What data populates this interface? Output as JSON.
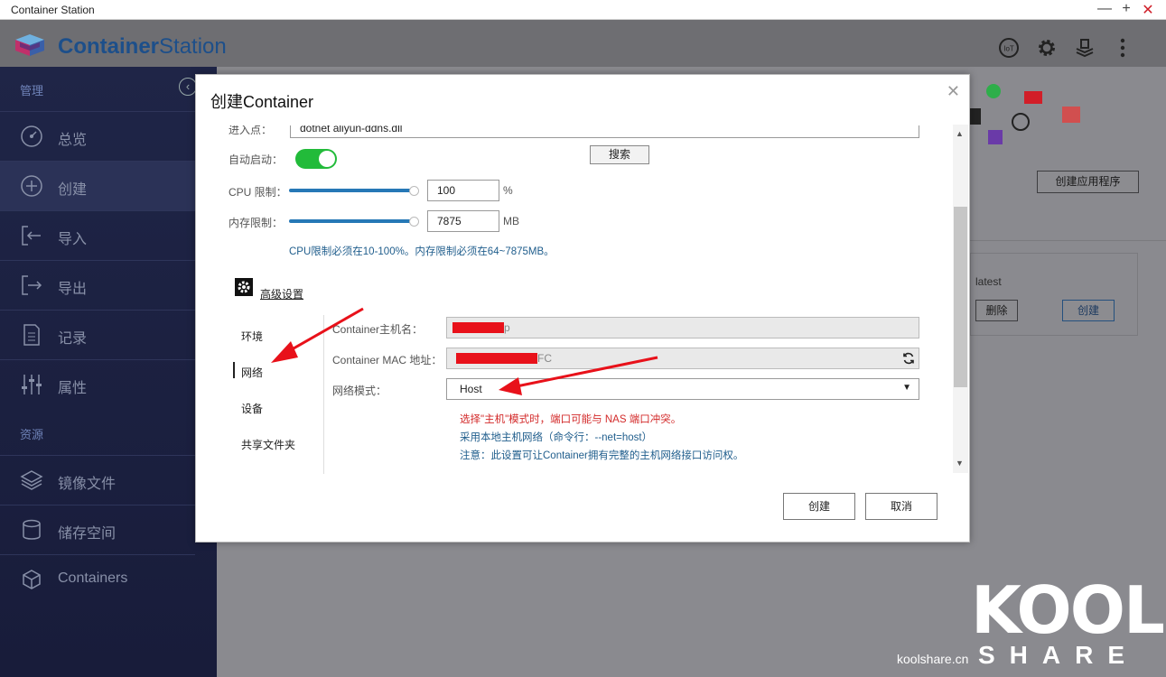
{
  "window": {
    "title": "Container Station",
    "minimize": "—",
    "maximize": "+",
    "close": "✕"
  },
  "header": {
    "brand_bold": "Container",
    "brand_light": "Station",
    "icons": [
      "iot-icon",
      "gear-icon",
      "layers-stack-icon",
      "more-vertical-icon"
    ],
    "iot_label": "IoT"
  },
  "sidebar": {
    "section_manage": "管理",
    "section_resources": "资源",
    "items": [
      {
        "label": "总览",
        "icon": "dashboard-icon"
      },
      {
        "label": "创建",
        "icon": "plus-circle-icon",
        "active": true
      },
      {
        "label": "导入",
        "icon": "import-icon"
      },
      {
        "label": "导出",
        "icon": "export-icon"
      },
      {
        "label": "记录",
        "icon": "document-icon"
      },
      {
        "label": "属性",
        "icon": "sliders-icon"
      }
    ],
    "resources": [
      {
        "label": "镜像文件",
        "icon": "layers-icon"
      },
      {
        "label": "储存空间",
        "icon": "database-icon"
      },
      {
        "label": "Containers",
        "icon": "cube-icon"
      }
    ]
  },
  "background": {
    "create_app_button": "创建应用程序",
    "image_tag": "latest",
    "delete_button": "删除",
    "create_button": "创建"
  },
  "modal": {
    "title": "创建Container",
    "entry_label": "进入点：",
    "entry_value": "dotnet aliyun-ddns.dll",
    "search_button": "搜索",
    "autostart_label": "自动启动：",
    "autostart_on": true,
    "cpu_label": "CPU 限制：",
    "cpu_value": "100",
    "cpu_unit": "%",
    "mem_label": "内存限制：",
    "mem_value": "7875",
    "mem_unit": "MB",
    "limit_note": "CPU限制必须在10-100%。内存限制必须在64~7875MB。",
    "advanced_label": "高级设置",
    "tabs": [
      "环境",
      "网络",
      "设备",
      "共享文件夹"
    ],
    "active_tab": "网络",
    "hostname_label": "Container主机名：",
    "hostname_value": "p",
    "mac_label": "Container MAC 地址：",
    "mac_value": "FC",
    "network_mode_label": "网络模式：",
    "network_mode_value": "Host",
    "warning_note": "选择\"主机\"模式时，端口可能与 NAS 端口冲突。",
    "host_note": "采用本地主机网络（命令行：--net=host）",
    "access_note": "注意：此设置可让Container拥有完整的主机网络接口访问权。",
    "create_button": "创建",
    "cancel_button": "取消"
  },
  "watermark": {
    "top": "KOOL",
    "bottom": "SHARE",
    "url": "koolshare.cn"
  },
  "colors": {
    "sidebar_bg": "#1f2547",
    "accent": "#2678b6",
    "toggle_on": "#22bb3a",
    "warning": "#d32a2a",
    "annotation_arrow": "#e8111a"
  }
}
